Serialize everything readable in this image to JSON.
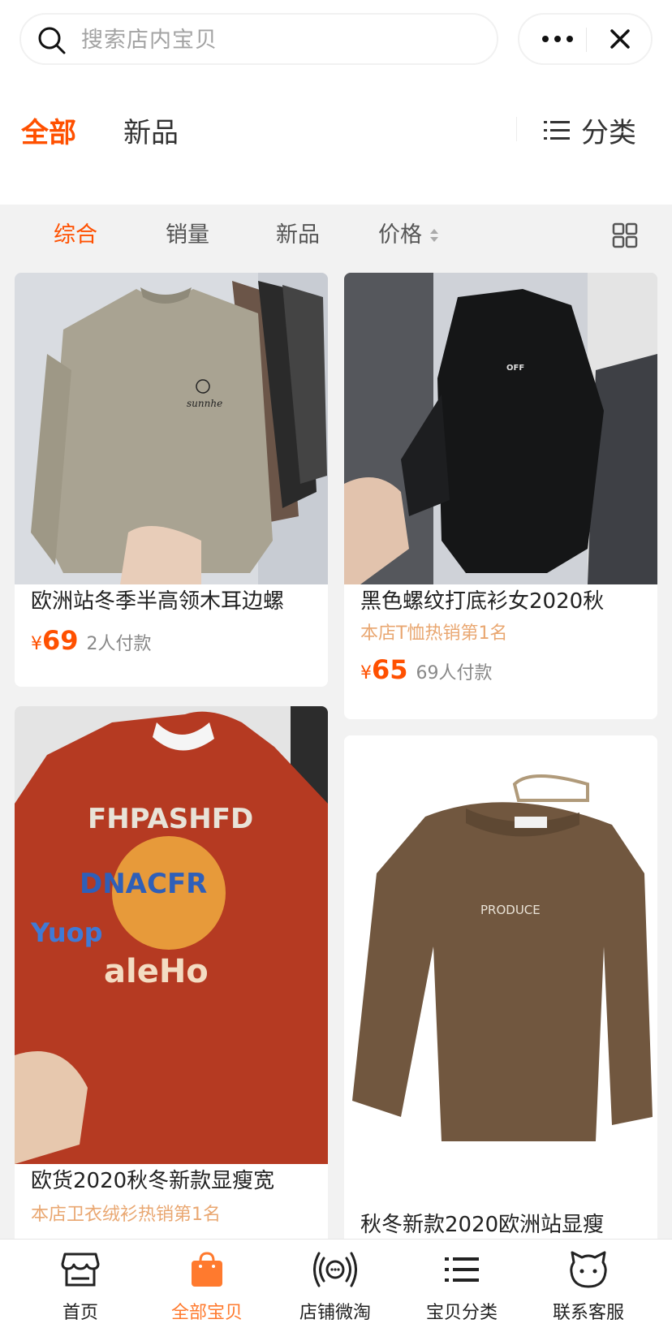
{
  "search": {
    "placeholder": "搜索店内宝贝"
  },
  "store_tabs": {
    "all": "全部",
    "new": "新品",
    "category": "分类"
  },
  "sort_bar": {
    "items": [
      "综合",
      "销量",
      "新品",
      "价格"
    ],
    "active_index": 0
  },
  "products": [
    {
      "name": "欧洲站冬季半高领木耳边螺",
      "tagline": "",
      "currency": "¥",
      "price": "69",
      "sold": "2人付款",
      "image": "beige-mock-neck-sweater"
    },
    {
      "name": "黑色螺纹打底衫女2020秋",
      "tagline": "本店T恤热销第1名",
      "currency": "¥",
      "price": "65",
      "sold": "69人付款",
      "image": "black-turtleneck-top"
    },
    {
      "name": "欧货2020秋冬新款显瘦宽",
      "tagline": "本店卫衣绒衫热销第1名",
      "currency": "",
      "price": "",
      "sold": "",
      "image": "red-graphic-sweatshirt"
    },
    {
      "name": "秋冬新款2020欧洲站显瘦",
      "tagline": "",
      "currency": "",
      "price": "",
      "sold": "",
      "image": "brown-produce-sweater"
    }
  ],
  "product_graphics": {
    "sweater_logo": "sunnhe",
    "tee_logo": "OFF",
    "print_line1": "FHPASHFD",
    "print_line2": "DNACFR",
    "print_line3": "Yuop",
    "print_line4": "aleHo",
    "brown_logo": "PRODUCE"
  },
  "bottom_nav": [
    {
      "label": "首页",
      "icon": "store-icon"
    },
    {
      "label": "全部宝贝",
      "icon": "shopping-bag-icon",
      "active": true
    },
    {
      "label": "店铺微淘",
      "icon": "broadcast-icon"
    },
    {
      "label": "宝贝分类",
      "icon": "list-icon"
    },
    {
      "label": "联系客服",
      "icon": "chat-face-icon"
    }
  ],
  "colors": {
    "accent": "#ff5000",
    "active_nav": "#ff7a2e",
    "tagline": "#e9a771",
    "background": "#f2f2f2"
  }
}
